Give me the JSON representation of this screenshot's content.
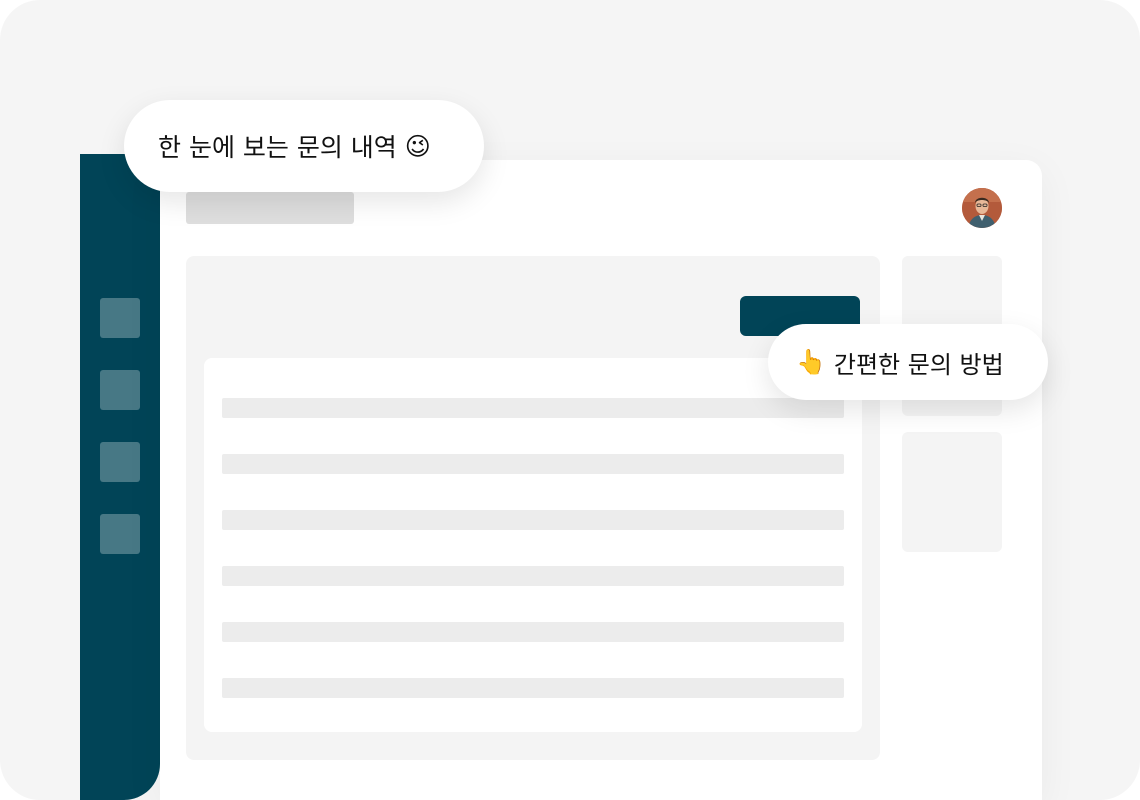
{
  "callouts": {
    "inquiry_history": {
      "text": "한 눈에 보는 문의 내역",
      "emoji": "😉"
    },
    "easy_inquiry": {
      "text": "간편한 문의 방법",
      "emoji": "👆"
    }
  },
  "sidebar": {
    "items": [
      {
        "icon": "menu-item-placeholder-icon"
      },
      {
        "icon": "menu-item-placeholder-icon"
      },
      {
        "icon": "menu-item-placeholder-icon"
      },
      {
        "icon": "menu-item-placeholder-icon"
      }
    ]
  },
  "header": {
    "avatar_icon": "user-avatar"
  },
  "colors": {
    "brand": "#014457",
    "stage_background": "#f5f5f5",
    "skeleton": "#ececec",
    "card": "#ffffff"
  }
}
